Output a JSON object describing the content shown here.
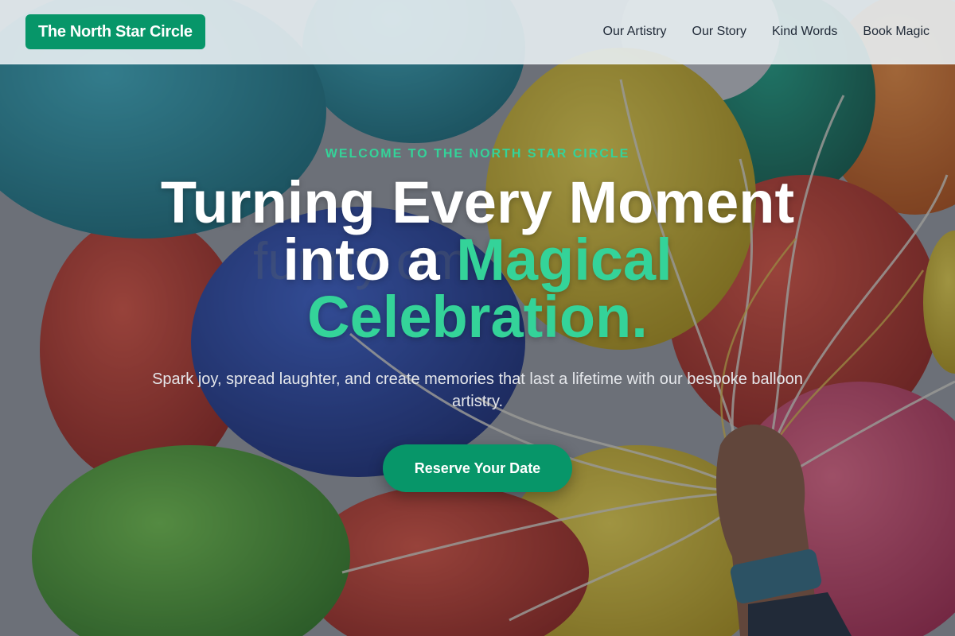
{
  "header": {
    "brand": "The North Star Circle",
    "nav": [
      {
        "label": "Our Artistry"
      },
      {
        "label": "Our Story"
      },
      {
        "label": "Kind Words"
      },
      {
        "label": "Book Magic"
      }
    ]
  },
  "hero": {
    "eyebrow": "WELCOME TO THE NORTH STAR CIRCLE",
    "headline_plain": "Turning Every Moment into a ",
    "headline_accent": "Magical Celebration.",
    "subtitle": "Spark joy, spread laughter, and create memories that last a lifetime with our bespoke balloon artistry.",
    "cta_label": "Reserve Your Date",
    "watermark": "funny        om"
  },
  "colors": {
    "brand_green": "#079669",
    "accent_green": "#34d399",
    "header_bg": "#e8eef2",
    "nav_text": "#1f2937"
  }
}
